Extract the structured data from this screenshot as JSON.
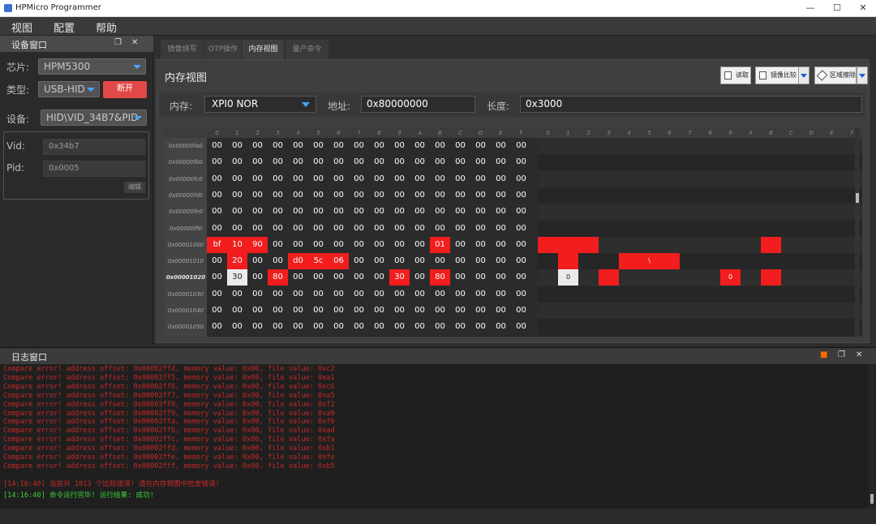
{
  "window": {
    "title": "HPMicro Programmer",
    "minimize": "—",
    "maximize": "☐",
    "close": "✕"
  },
  "menu": [
    "视图",
    "配置",
    "帮助"
  ],
  "device_panel": {
    "title": "设备窗口",
    "chip_label": "芯片:",
    "chip_value": "HPM5300",
    "type_label": "类型:",
    "type_value": "USB-HID",
    "disconnect_label": "断开",
    "device_label": "设备:",
    "device_value": "HID\\VID_34B7&PID",
    "vid_label": "Vid:",
    "vid_value": "0x34b7",
    "pid_label": "Pid:",
    "pid_value": "0x0005",
    "edit_label": "编辑"
  },
  "tabs": [
    {
      "label": "镜像烧写",
      "active": false
    },
    {
      "label": "OTP操作",
      "active": false
    },
    {
      "label": "内存视图",
      "active": true
    },
    {
      "label": "量产命令",
      "active": false
    }
  ],
  "memory_view": {
    "title": "内存视图",
    "read_label": "读取",
    "compare_label": "镜像比较",
    "erase_label": "区域擦除",
    "memory_label": "内存:",
    "memory_value": "XPI0 NOR",
    "address_label": "地址:",
    "address_value": "0x80000000",
    "length_label": "长度:",
    "length_value": "0x3000",
    "hex_headers": [
      "0",
      "1",
      "2",
      "3",
      "4",
      "5",
      "6",
      "7",
      "8",
      "9",
      "A",
      "B",
      "C",
      "D",
      "E",
      "F"
    ],
    "ascii_headers": [
      "0",
      "1",
      "2",
      "3",
      "4",
      "5",
      "6",
      "7",
      "8",
      "9",
      "A",
      "B",
      "C",
      "D",
      "E",
      "F"
    ],
    "rows": [
      {
        "addr": "0x00000fa0",
        "bold": false,
        "bytes": [
          "00",
          "00",
          "00",
          "00",
          "00",
          "00",
          "00",
          "00",
          "00",
          "00",
          "00",
          "00",
          "00",
          "00",
          "00",
          "00"
        ],
        "hl": [],
        "ascii": []
      },
      {
        "addr": "0x00000fb0",
        "bold": false,
        "bytes": [
          "00",
          "00",
          "00",
          "00",
          "00",
          "00",
          "00",
          "00",
          "00",
          "00",
          "00",
          "00",
          "00",
          "00",
          "00",
          "00"
        ],
        "hl": [],
        "ascii": []
      },
      {
        "addr": "0x00000fc0",
        "bold": false,
        "bytes": [
          "00",
          "00",
          "00",
          "00",
          "00",
          "00",
          "00",
          "00",
          "00",
          "00",
          "00",
          "00",
          "00",
          "00",
          "00",
          "00"
        ],
        "hl": [],
        "ascii": []
      },
      {
        "addr": "0x00000fd0",
        "bold": false,
        "bytes": [
          "00",
          "00",
          "00",
          "00",
          "00",
          "00",
          "00",
          "00",
          "00",
          "00",
          "00",
          "00",
          "00",
          "00",
          "00",
          "00"
        ],
        "hl": [],
        "ascii": []
      },
      {
        "addr": "0x00000fe0",
        "bold": false,
        "bytes": [
          "00",
          "00",
          "00",
          "00",
          "00",
          "00",
          "00",
          "00",
          "00",
          "00",
          "00",
          "00",
          "00",
          "00",
          "00",
          "00"
        ],
        "hl": [],
        "ascii": []
      },
      {
        "addr": "0x00000ff0",
        "bold": false,
        "bytes": [
          "00",
          "00",
          "00",
          "00",
          "00",
          "00",
          "00",
          "00",
          "00",
          "00",
          "00",
          "00",
          "00",
          "00",
          "00",
          "00"
        ],
        "hl": [],
        "ascii": []
      },
      {
        "addr": "0x00001000",
        "bold": false,
        "bytes": [
          "bf",
          "10",
          "90",
          "00",
          "00",
          "00",
          "00",
          "00",
          "00",
          "00",
          "00",
          "01",
          "00",
          "00",
          "00",
          "00"
        ],
        "hl": [
          0,
          1,
          2,
          11
        ],
        "ascii": [
          {
            "i": 0,
            "c": "",
            "s": "red"
          },
          {
            "i": 1,
            "c": "",
            "s": "red"
          },
          {
            "i": 2,
            "c": "",
            "s": "red"
          },
          {
            "i": 11,
            "c": "",
            "s": "red"
          }
        ]
      },
      {
        "addr": "0x00001010",
        "bold": false,
        "bytes": [
          "00",
          "20",
          "00",
          "00",
          "d0",
          "5c",
          "06",
          "00",
          "00",
          "00",
          "00",
          "00",
          "00",
          "00",
          "00",
          "00"
        ],
        "hl": [
          1,
          4,
          5,
          6
        ],
        "ascii": [
          {
            "i": 1,
            "c": "",
            "s": "red"
          },
          {
            "i": 4,
            "c": "",
            "s": "red"
          },
          {
            "i": 5,
            "c": "\\",
            "s": "red"
          },
          {
            "i": 6,
            "c": "",
            "s": "red"
          }
        ]
      },
      {
        "addr": "0x00001020",
        "bold": true,
        "bytes": [
          "00",
          "30",
          "00",
          "80",
          "00",
          "00",
          "00",
          "00",
          "00",
          "30",
          "00",
          "80",
          "00",
          "00",
          "00",
          "00"
        ],
        "hl": [
          3,
          9,
          11
        ],
        "wh": [
          1
        ],
        "ascii": [
          {
            "i": 1,
            "c": "0",
            "s": "white"
          },
          {
            "i": 3,
            "c": "",
            "s": "red"
          },
          {
            "i": 9,
            "c": "0",
            "s": "red"
          },
          {
            "i": 11,
            "c": "",
            "s": "red"
          }
        ]
      },
      {
        "addr": "0x00001030",
        "bold": false,
        "bytes": [
          "00",
          "00",
          "00",
          "00",
          "00",
          "00",
          "00",
          "00",
          "00",
          "00",
          "00",
          "00",
          "00",
          "00",
          "00",
          "00"
        ],
        "hl": [],
        "ascii": []
      },
      {
        "addr": "0x00001040",
        "bold": false,
        "bytes": [
          "00",
          "00",
          "00",
          "00",
          "00",
          "00",
          "00",
          "00",
          "00",
          "00",
          "00",
          "00",
          "00",
          "00",
          "00",
          "00"
        ],
        "hl": [],
        "ascii": []
      },
      {
        "addr": "0x00001050",
        "bold": false,
        "bytes": [
          "00",
          "00",
          "00",
          "00",
          "00",
          "00",
          "00",
          "00",
          "00",
          "00",
          "00",
          "00",
          "00",
          "00",
          "00",
          "00"
        ],
        "hl": [],
        "ascii": []
      }
    ]
  },
  "log": {
    "title": "日志窗口",
    "errors": [
      "Compare error! address offset: 0x00002ff4, memory value: 0x00, file value: 0xc2",
      "Compare error! address offset: 0x00002ff5, memory value: 0x00, file value: 0xa1",
      "Compare error! address offset: 0x00002ff6, memory value: 0x00, file value: 0xc6",
      "Compare error! address offset: 0x00002ff7, memory value: 0x00, file value: 0xa5",
      "Compare error! address offset: 0x00002ff8, memory value: 0x00, file value: 0xf2",
      "Compare error! address offset: 0x00002ff9, memory value: 0x00, file value: 0xa9",
      "Compare error! address offset: 0x00002ffa, memory value: 0x00, file value: 0xf6",
      "Compare error! address offset: 0x00002ffb, memory value: 0x00, file value: 0xad",
      "Compare error! address offset: 0x00002ffc, memory value: 0x00, file value: 0xfa",
      "Compare error! address offset: 0x00002ffd, memory value: 0x00, file value: 0xb1",
      "Compare error! address offset: 0x00002ffe, memory value: 0x00, file value: 0xfe",
      "Compare error! address offset: 0x00002fff, memory value: 0x00, file value: 0xb5"
    ],
    "summary_error": "[14:16:40] 当前共 1013 个比较错误! 请在内存视图中检查错误!",
    "summary_ok": "[14:16:40] 命令运行完毕! 运行结果: 成功!"
  },
  "colors": {
    "highlight_red": "#f21d1d",
    "highlight_white": "#eaeaea",
    "error_text": "#c62828",
    "ok_text": "#38d038",
    "accent_blue": "#4aa3ff"
  }
}
